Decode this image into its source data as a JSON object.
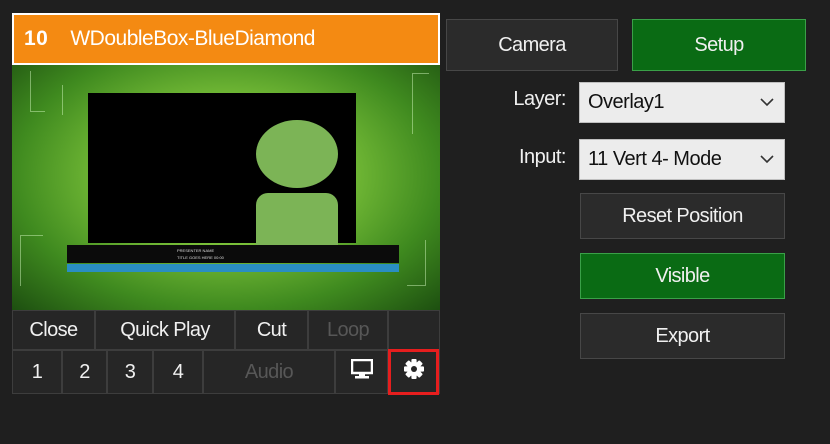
{
  "input": {
    "number": "10",
    "name": "WDoubleBox-BlueDiamond"
  },
  "preview": {
    "lower_third_line1": "PRESENTER NAME",
    "lower_third_line2": "TITLE GOES HERE 00:00"
  },
  "controls": {
    "row1": [
      {
        "label": "Close",
        "enabled": true
      },
      {
        "label": "Quick Play",
        "enabled": true
      },
      {
        "label": "Cut",
        "enabled": true
      },
      {
        "label": "Loop",
        "enabled": false
      }
    ],
    "row2": [
      {
        "label": "1",
        "enabled": true
      },
      {
        "label": "2",
        "enabled": true
      },
      {
        "label": "3",
        "enabled": true
      },
      {
        "label": "4",
        "enabled": true
      },
      {
        "label": "Audio",
        "enabled": false
      }
    ],
    "monitor_icon": "monitor-icon",
    "settings_icon": "gear-icon"
  },
  "tabs": {
    "camera": "Camera",
    "setup": "Setup",
    "active": "Setup"
  },
  "fields": {
    "layer_label": "Layer:",
    "layer_value": "Overlay1",
    "input_label": "Input:",
    "input_value": "11 Vert 4- Mode"
  },
  "actions": {
    "reset_position": "Reset Position",
    "visible": "Visible",
    "export": "Export"
  },
  "colors": {
    "title_bar": "#f48a12",
    "active_green": "#0a6b14",
    "highlight": "#e61e1e",
    "background": "#1f1f1f"
  }
}
